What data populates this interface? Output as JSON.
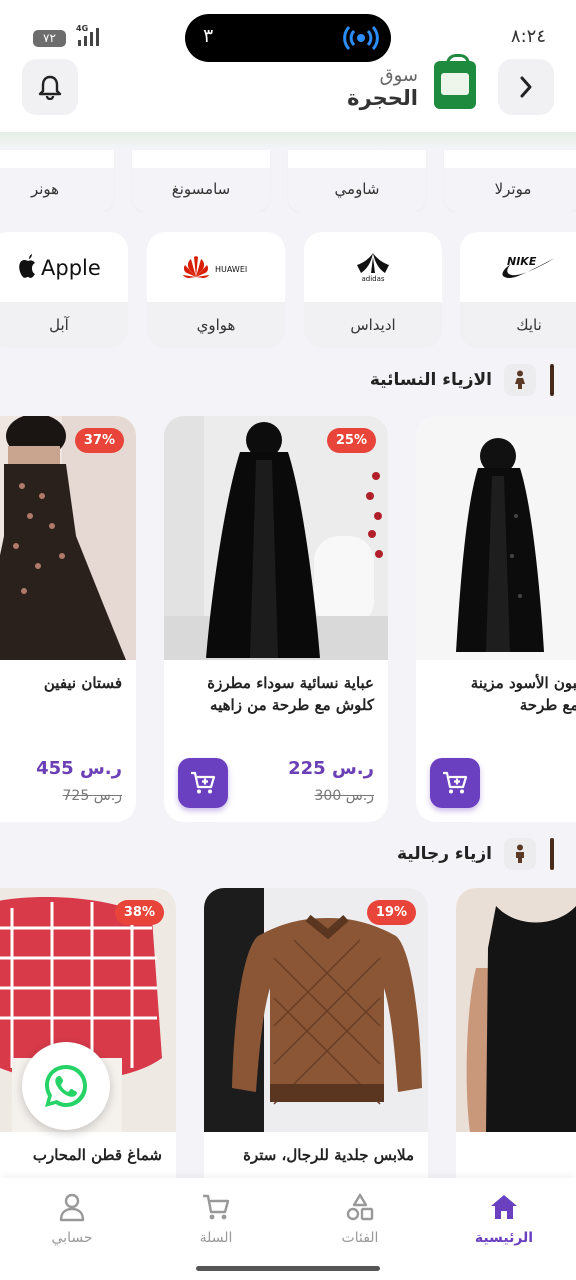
{
  "status_bar": {
    "time": "٨:٢٤",
    "battery": "٧٢",
    "network": "4G",
    "island_number": "٣"
  },
  "header": {
    "store_name_line1": "سوق",
    "store_name_line2": "الحجرة"
  },
  "text_brands": [
    "موترلا",
    "شاومي",
    "سامسونغ",
    "هونر"
  ],
  "logo_brands": [
    {
      "logo_text": "NIKE",
      "label": "نايك"
    },
    {
      "logo_text": "adidas",
      "label": "اديداس"
    },
    {
      "logo_text": "HUAWEI",
      "label": "هواوي"
    },
    {
      "logo_text": "Apple",
      "label": "آبل"
    }
  ],
  "sections": [
    {
      "title": "الازياء النسائية",
      "products": [
        {
          "name": "عباية بالبون الأسود مزينة بالورود مع طرحة",
          "price": "",
          "old_price": "",
          "badge": ""
        },
        {
          "name": "عباية نسائية سوداء مطرزة كلوش مع طرحة من زاهيه",
          "price": "225 ر.س",
          "old_price": "300 ر.س",
          "badge": "25%"
        },
        {
          "name": "فستان نيفين",
          "price": "455 ر.س",
          "old_price": "725 ر.س",
          "badge": "37%"
        }
      ]
    },
    {
      "title": "ازياء رجالية",
      "products": [
        {
          "name": "",
          "badge": ""
        },
        {
          "name": "ملابس جلدية للرجال، سترة",
          "badge": "19%"
        },
        {
          "name": "شماغ قطن المحارب",
          "badge": "38%"
        }
      ]
    }
  ],
  "bottom_nav": [
    {
      "label": "الرئيسية",
      "icon": "home-icon",
      "active": true
    },
    {
      "label": "الفئات",
      "icon": "categories-icon",
      "active": false
    },
    {
      "label": "السلة",
      "icon": "cart-icon",
      "active": false
    },
    {
      "label": "حسابي",
      "icon": "user-icon",
      "active": false
    }
  ],
  "colors": {
    "accent": "#6a3fc0",
    "badge": "#e8443a",
    "logo_green": "#1e8a3e"
  }
}
